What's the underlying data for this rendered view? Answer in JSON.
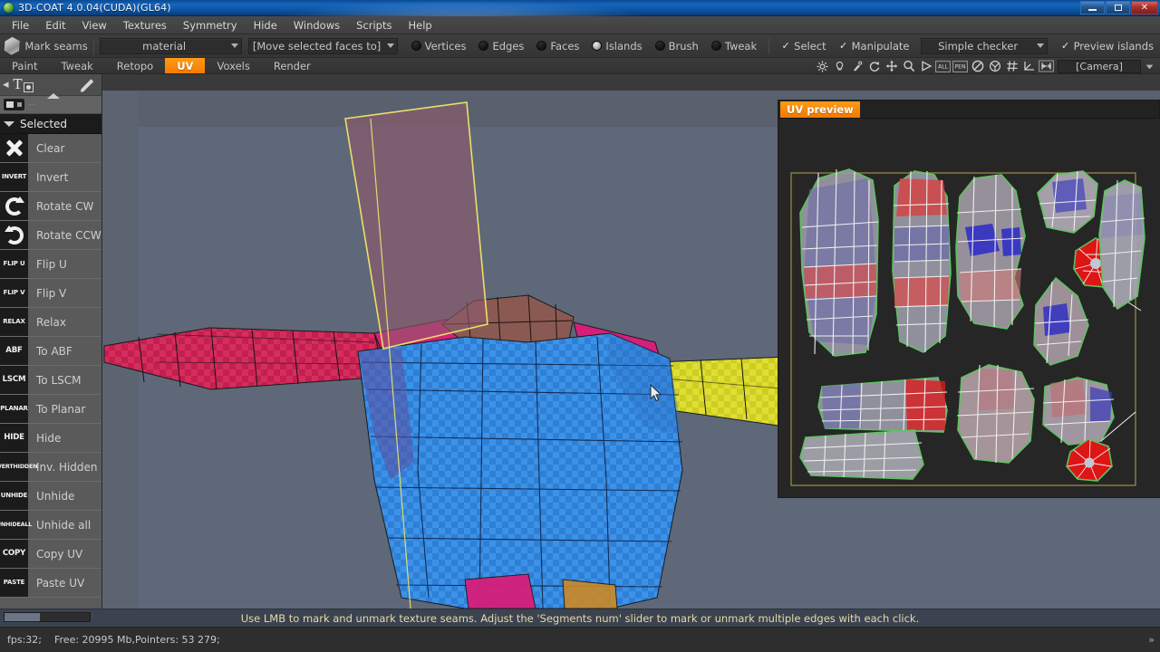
{
  "window": {
    "title": "3D-COAT 4.0.04(CUDA)(GL64)",
    "minimize_label": "–",
    "restore_label": "❐",
    "close_label": "✕"
  },
  "menu": {
    "items": [
      {
        "label": "File"
      },
      {
        "label": "Edit"
      },
      {
        "label": "View"
      },
      {
        "label": "Textures"
      },
      {
        "label": "Symmetry"
      },
      {
        "label": "Hide"
      },
      {
        "label": "Windows"
      },
      {
        "label": "Scripts"
      },
      {
        "label": "Help"
      }
    ]
  },
  "toolbar": {
    "tool_label": "Mark seams",
    "tool_icon": "cube-icon",
    "material_combo": {
      "value": "material",
      "icon": "chevron-down-icon"
    },
    "move_faces_combo": {
      "value": "[Move selected faces to]",
      "icon": "chevron-down-icon"
    },
    "modes": [
      {
        "label": "Vertices",
        "selected": false
      },
      {
        "label": "Edges",
        "selected": false
      },
      {
        "label": "Faces",
        "selected": false
      },
      {
        "label": "Islands",
        "selected": true
      },
      {
        "label": "Brush",
        "selected": false
      },
      {
        "label": "Tweak",
        "selected": false
      }
    ],
    "select_check": {
      "label": "Select",
      "checked": true,
      "mark": "✓"
    },
    "manipulate_check": {
      "label": "Manipulate",
      "checked": true,
      "mark": "✓"
    },
    "checker_combo": {
      "value": "Simple checker",
      "icon": "chevron-down-icon"
    },
    "preview_islands_check": {
      "label": "Preview islands",
      "checked": true,
      "mark": "✓"
    }
  },
  "tabs": {
    "items": [
      {
        "label": "Paint",
        "active": false
      },
      {
        "label": "Tweak",
        "active": false
      },
      {
        "label": "Retopo",
        "active": false
      },
      {
        "label": "UV",
        "active": true
      },
      {
        "label": "Voxels",
        "active": false
      },
      {
        "label": "Render",
        "active": false
      }
    ]
  },
  "viewport_tools": {
    "icons": [
      "sun-icon",
      "lightbulb-icon",
      "pick-light-icon",
      "rotate-icon",
      "move-icon",
      "zoom-icon",
      "play-icon",
      "all-icon",
      "pen-icon",
      "no-icon",
      "uv-sphere-icon",
      "grid-icon",
      "axis-icon",
      "fit-icon"
    ],
    "camera_combo": {
      "value": "[Camera]",
      "icon": "chevron-down-icon"
    }
  },
  "sidebar": {
    "top_icons": [
      "back-arrow-icon",
      "text-tool-icon",
      "pen-icon",
      "camera-icon",
      "up-arrow-icon"
    ],
    "section": {
      "label": "Selected",
      "icon": "triangle-down-icon",
      "expanded": true
    },
    "items": [
      {
        "label": "Clear",
        "badge": "",
        "badge_kind": "x-glyph"
      },
      {
        "label": "Invert",
        "badge": "INVERT",
        "badge_kind": "text"
      },
      {
        "label": "Rotate CW",
        "badge": "",
        "badge_kind": "rot-cw"
      },
      {
        "label": "Rotate CCW",
        "badge": "",
        "badge_kind": "rot-ccw"
      },
      {
        "label": "Flip U",
        "badge": "FLIP U",
        "badge_kind": "text"
      },
      {
        "label": "Flip V",
        "badge": "FLIP V",
        "badge_kind": "text"
      },
      {
        "label": "Relax",
        "badge": "RELAX",
        "badge_kind": "text"
      },
      {
        "label": "To ABF",
        "badge": "ABF",
        "badge_kind": "text-big"
      },
      {
        "label": "To LSCM",
        "badge": "LSCM",
        "badge_kind": "text-big"
      },
      {
        "label": "To Planar",
        "badge": "PLANAR",
        "badge_kind": "text"
      },
      {
        "label": "Hide",
        "badge": "HIDE",
        "badge_kind": "text-big"
      },
      {
        "label": "Inv. Hidden",
        "badge": "INVERT|HIDDEN",
        "badge_kind": "text-two"
      },
      {
        "label": "Unhide",
        "badge": "UNHIDE",
        "badge_kind": "text"
      },
      {
        "label": "Unhide all",
        "badge": "UNHIDE|ALL",
        "badge_kind": "text-two"
      },
      {
        "label": "Copy UV",
        "badge": "COPY",
        "badge_kind": "text-big"
      },
      {
        "label": "Paste UV",
        "badge": "PASTE",
        "badge_kind": "text"
      }
    ]
  },
  "uv_preview": {
    "tab_label": "UV preview",
    "background": "#262626",
    "uv_border_color": "#9e9043"
  },
  "status": {
    "hint": "Use LMB to mark and unmark texture seams. Adjust the 'Segments num' slider to mark or unmark multiple edges with each click.",
    "fps": "fps:32;",
    "memory": "Free: 20995 Mb,Pointers: 53 279;",
    "right_mark": "»"
  },
  "colors": {
    "accent_orange": "#f58410",
    "title_blue": "#1565c0",
    "viewport_bg": "#5e6878",
    "sidebar_bg": "#5a5a5a",
    "status_text": "#e7d9a8",
    "selection_outline": "#e8e06a"
  }
}
